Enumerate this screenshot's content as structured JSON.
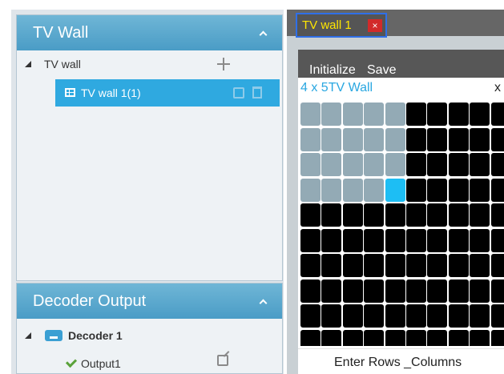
{
  "left_panel": {
    "tvwall_panel": {
      "title": "TV Wall",
      "tree": {
        "root_label": "TV wall",
        "selected_item_label": "TV wall 1(1)"
      }
    },
    "decoder_panel": {
      "title": "Decoder Output",
      "decoder_label": "Decoder 1",
      "output_label": "Output1"
    }
  },
  "right_panel": {
    "tab": {
      "label": "TV wall 1",
      "close_label": "×"
    },
    "toolbar": {
      "initialize_label": "Initialize",
      "save_label": "Save"
    },
    "wall": {
      "title": "4 x 5TV Wall",
      "close_label": "x",
      "selected_rows": 4,
      "selected_cols": 5,
      "active_cell": {
        "row": 4,
        "col": 5
      }
    },
    "bottom_label": "Enter Rows _Columns"
  },
  "colors": {
    "header_blue": "#4a9cc6",
    "selected_row_blue": "#2fa9e0",
    "tab_text_yellow": "#ffe600",
    "wall_title_blue": "#29a7e1",
    "cell_selected_gray": "#93aab5",
    "cell_active_cyan": "#1dbef4"
  },
  "icons": [
    "chevron-up-icon",
    "plus-icon",
    "grid-icon",
    "edit-icon",
    "trash-icon",
    "decoder-icon",
    "check-icon",
    "close-icon"
  ]
}
